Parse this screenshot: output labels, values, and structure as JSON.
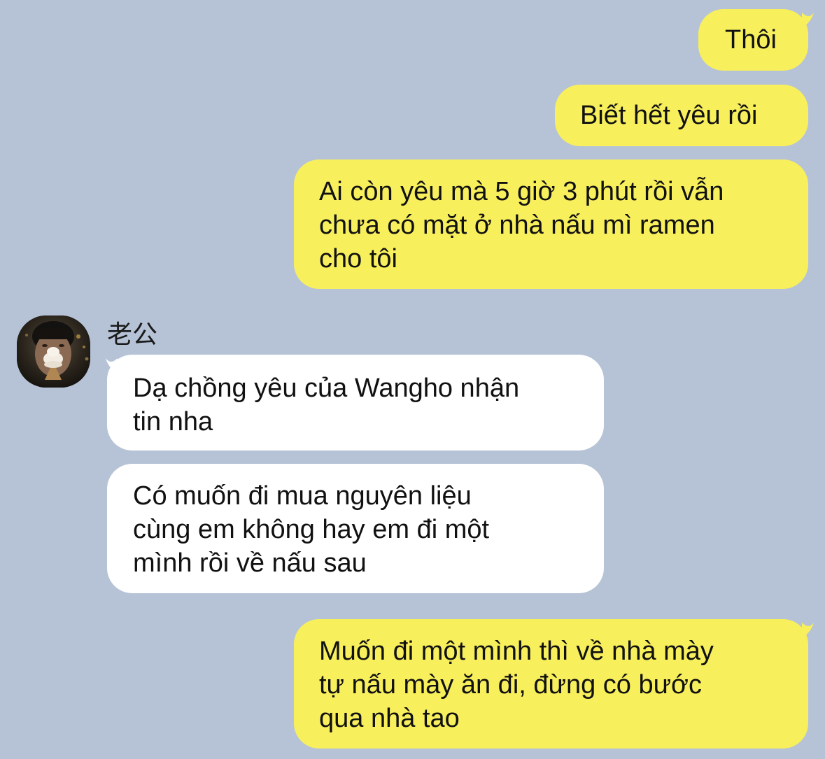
{
  "conversation": {
    "messages": [
      {
        "direction": "outgoing",
        "text": "Thôi"
      },
      {
        "direction": "outgoing",
        "text": "Biết hết yêu rồi"
      },
      {
        "direction": "outgoing",
        "text": "Ai còn yêu mà 5 giờ 3 phút rồi vẫn\nchưa có mặt ở nhà nấu mì ramen\ncho tôi"
      },
      {
        "direction": "incoming",
        "sender": "老公",
        "text": "Dạ chồng yêu của Wangho nhận\ntin nha"
      },
      {
        "direction": "incoming",
        "sender": "老公",
        "text": "Có muốn đi mua nguyên liệu\ncùng em không hay em đi một\nmình rồi về nấu sau"
      },
      {
        "direction": "outgoing",
        "text": "Muốn đi một mình thì về nhà mày\ntự nấu mày ăn đi, đừng có bước\nqua nhà tao"
      }
    ]
  },
  "contact": {
    "name": "老公",
    "avatar_icon": "avatar-photo-icecream"
  },
  "colors": {
    "background": "#b6c3d6",
    "outgoing_bubble": "#f8ef5c",
    "incoming_bubble": "#ffffff",
    "text": "#111111"
  }
}
